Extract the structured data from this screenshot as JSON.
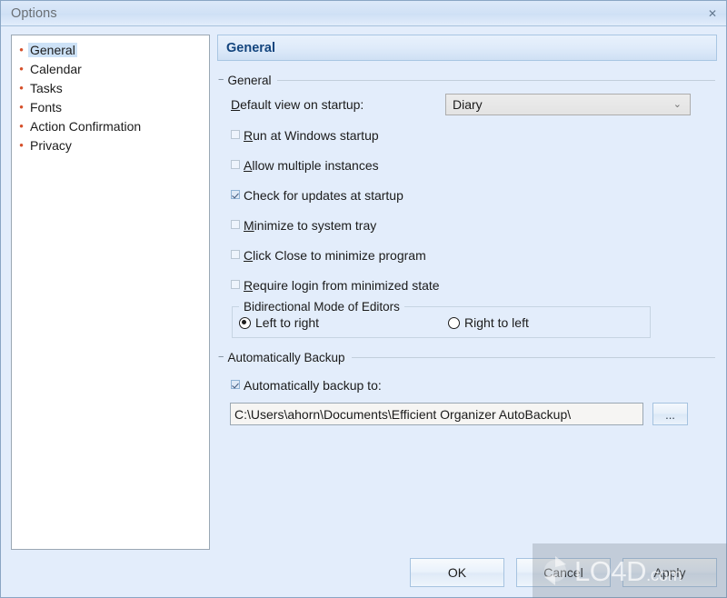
{
  "window": {
    "title": "Options",
    "close_icon": "close-icon",
    "close_label": "✕"
  },
  "sidebar": {
    "items": [
      {
        "label": "General",
        "selected": true
      },
      {
        "label": "Calendar",
        "selected": false
      },
      {
        "label": "Tasks",
        "selected": false
      },
      {
        "label": "Fonts",
        "selected": false
      },
      {
        "label": "Action Confirmation",
        "selected": false
      },
      {
        "label": "Privacy",
        "selected": false
      }
    ],
    "bullet_glyph": "•",
    "bullet_color": "#d6502a"
  },
  "pane": {
    "header_title": "General",
    "groups": {
      "general": {
        "title": "General",
        "collapse_glyph": "−",
        "default_view": {
          "label_pre": "D",
          "label_post": "efault view on startup:",
          "value": "Diary",
          "chevron": "⌄"
        },
        "checkboxes": [
          {
            "pre": "R",
            "post": "un at Windows startup",
            "checked": false
          },
          {
            "pre": "A",
            "post": "llow multiple instances",
            "checked": false
          },
          {
            "pre": "",
            "post": "Check for updates at startup",
            "checked": true,
            "mid_u": "u",
            "alt_text": "Check for updates at startup"
          },
          {
            "pre": "M",
            "post": "inimize to system tray",
            "checked": false
          },
          {
            "pre": "C",
            "post": "lick Close to minimize program",
            "checked": false
          },
          {
            "pre": "R",
            "post": "equire login from minimized state",
            "checked": false
          }
        ],
        "bidirectional": {
          "title": "Bidirectional Mode of Editors",
          "options": [
            {
              "label": "Left to right",
              "selected": true
            },
            {
              "label": "Right to left",
              "selected": false
            }
          ]
        }
      },
      "backup": {
        "title": "Automatically Backup",
        "collapse_glyph": "−",
        "checkbox": {
          "label": "Automatically backup to:",
          "checked": true
        },
        "path_value": "C:\\Users\\ahorn\\Documents\\Efficient Organizer AutoBackup\\",
        "browse_label": "..."
      }
    }
  },
  "footer": {
    "buttons": [
      {
        "label": "OK"
      },
      {
        "label": "Cancel"
      },
      {
        "label": "Apply"
      }
    ]
  },
  "watermark": {
    "text": "LO4D",
    "suffix": ".com"
  }
}
